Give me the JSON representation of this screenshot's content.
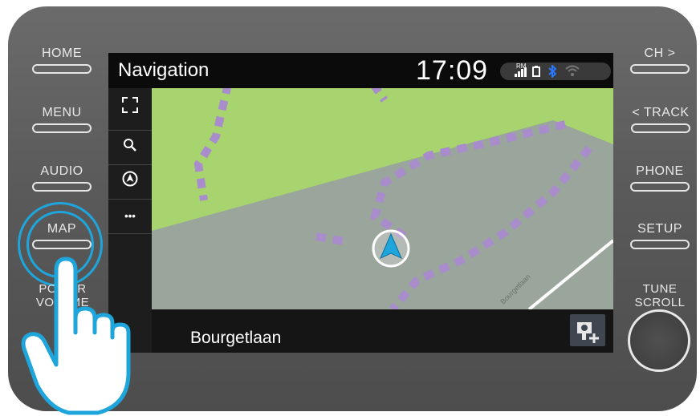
{
  "left_buttons": [
    {
      "label": "HOME"
    },
    {
      "label": "MENU"
    },
    {
      "label": "AUDIO"
    },
    {
      "label": "MAP"
    },
    {
      "label": "POWER VOLUME"
    }
  ],
  "right_buttons": [
    {
      "label": "CH >"
    },
    {
      "label": "< TRACK"
    },
    {
      "label": "PHONE"
    },
    {
      "label": "SETUP"
    },
    {
      "label": "TUNE SCROLL"
    }
  ],
  "screen": {
    "title": "Navigation",
    "time": "17:09",
    "status": {
      "signal_badge": "RM",
      "signal": "signal-bars-icon",
      "battery": "battery-icon",
      "bluetooth": "bluetooth-icon",
      "wifi": "wifi-icon"
    },
    "side_buttons": [
      {
        "icon": "expand-icon"
      },
      {
        "icon": "search-icon"
      },
      {
        "icon": "compass-icon"
      },
      {
        "icon": "more-icon",
        "label": "•••"
      }
    ],
    "street_name": "Bourgetlaan",
    "map_road_label": "Bourgetlaan",
    "camera_button_icon": "speed-camera-add-icon"
  },
  "colors": {
    "map_green": "#a7d46e",
    "map_grey": "#9aa59b",
    "route_purple": "#a98ccc",
    "accent_blue": "#1ea6dc"
  }
}
